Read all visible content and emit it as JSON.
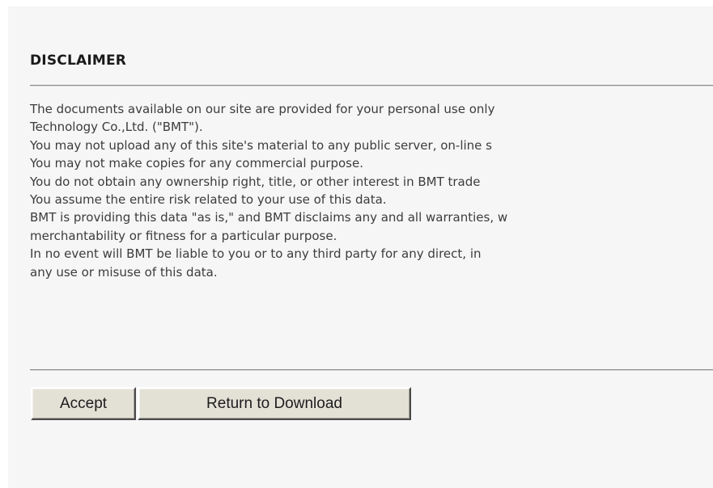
{
  "disclaimer": {
    "heading": "DISCLAIMER",
    "lines": [
      "The documents available on our site are provided for your personal use only",
      "Technology Co.,Ltd. (\"BMT\").",
      "You may not upload any of this site's material to any public server, on-line s",
      "You may not make copies for any commercial purpose.",
      "You do not obtain any ownership right, title, or other interest in BMT trade",
      "You assume the entire risk related to your use of this data.",
      "BMT is providing this data \"as is,\" and BMT disclaims any and all warranties, w",
      "merchantability or fitness for a particular purpose.",
      "In no event will BMT be liable to you or to any third party for any direct, in",
      "any use or misuse of this data."
    ]
  },
  "actions": {
    "accept_label": "Accept",
    "return_label": "Return to Download"
  }
}
